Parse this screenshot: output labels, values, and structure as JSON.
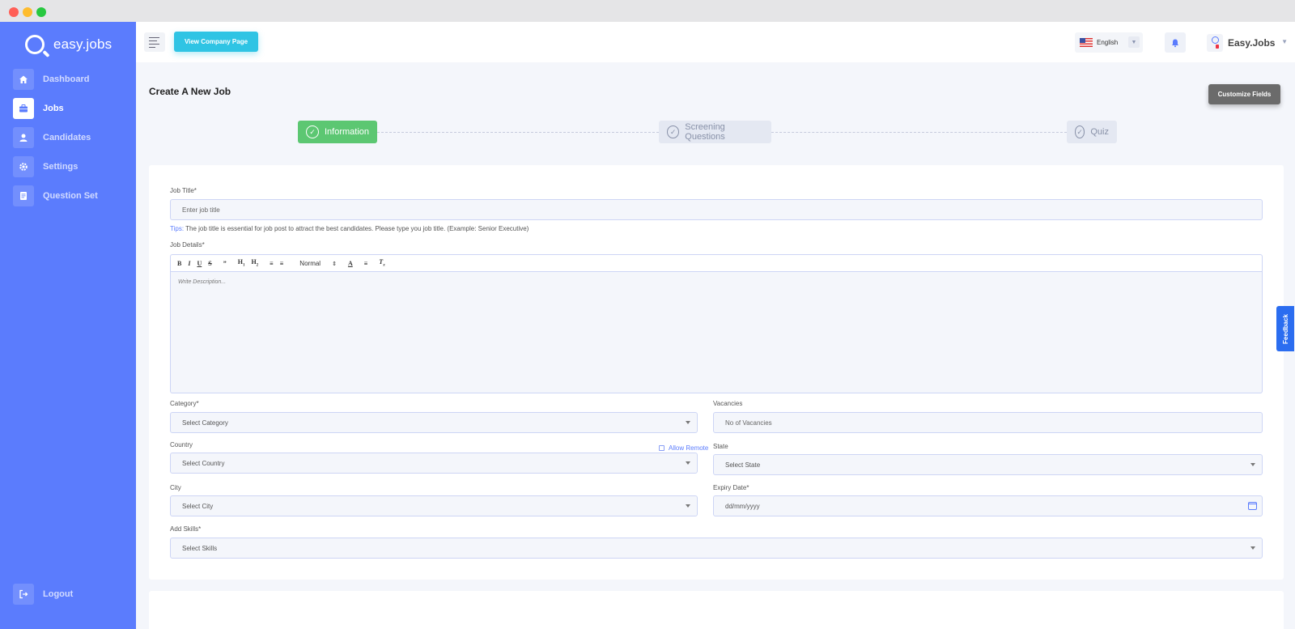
{
  "brand": {
    "name": "easy.jobs"
  },
  "sidebar": {
    "items": [
      {
        "label": "Dashboard",
        "icon": "home-icon"
      },
      {
        "label": "Jobs",
        "icon": "briefcase-icon",
        "active": true
      },
      {
        "label": "Candidates",
        "icon": "user-icon"
      },
      {
        "label": "Settings",
        "icon": "gear-icon"
      },
      {
        "label": "Question Set",
        "icon": "document-icon"
      }
    ],
    "logout_label": "Logout"
  },
  "topbar": {
    "view_company_label": "View Company Page",
    "language": "English",
    "user_name": "Easy.Jobs"
  },
  "page": {
    "title": "Create A New Job",
    "customize_label": "Customize Fields"
  },
  "steps": [
    {
      "label": "Information",
      "active": true
    },
    {
      "label": "Screening Questions",
      "active": false
    },
    {
      "label": "Quiz",
      "active": false
    }
  ],
  "form": {
    "job_title_label": "Job Title*",
    "job_title_placeholder": "Enter job title",
    "tips_key": "Tips:",
    "tips_text": "The job title is essential for job post to attract the best candidates. Please type you job title. (Example: Senior Executive)",
    "job_details_label": "Job Details*",
    "editor_format": "Normal",
    "editor_placeholder": "Write Description...",
    "category_label": "Category*",
    "category_value": "Select Category",
    "vacancies_label": "Vacancies",
    "vacancies_placeholder": "No of Vacancies",
    "country_label": "Country",
    "allow_remote_label": "Allow Remote",
    "country_value": "Select Country",
    "state_label": "State",
    "state_value": "Select State",
    "city_label": "City",
    "city_value": "Select City",
    "expiry_label": "Expiry Date*",
    "expiry_placeholder": "dd/mm/yyyy",
    "skills_label": "Add Skills*",
    "skills_value": "Select Skills"
  },
  "feedback_label": "Feedback",
  "colors": {
    "sidebar": "#5b7cfd",
    "accent_cyan": "#2fc4e4",
    "step_active": "#5cc772",
    "feedback": "#2b6df0"
  }
}
